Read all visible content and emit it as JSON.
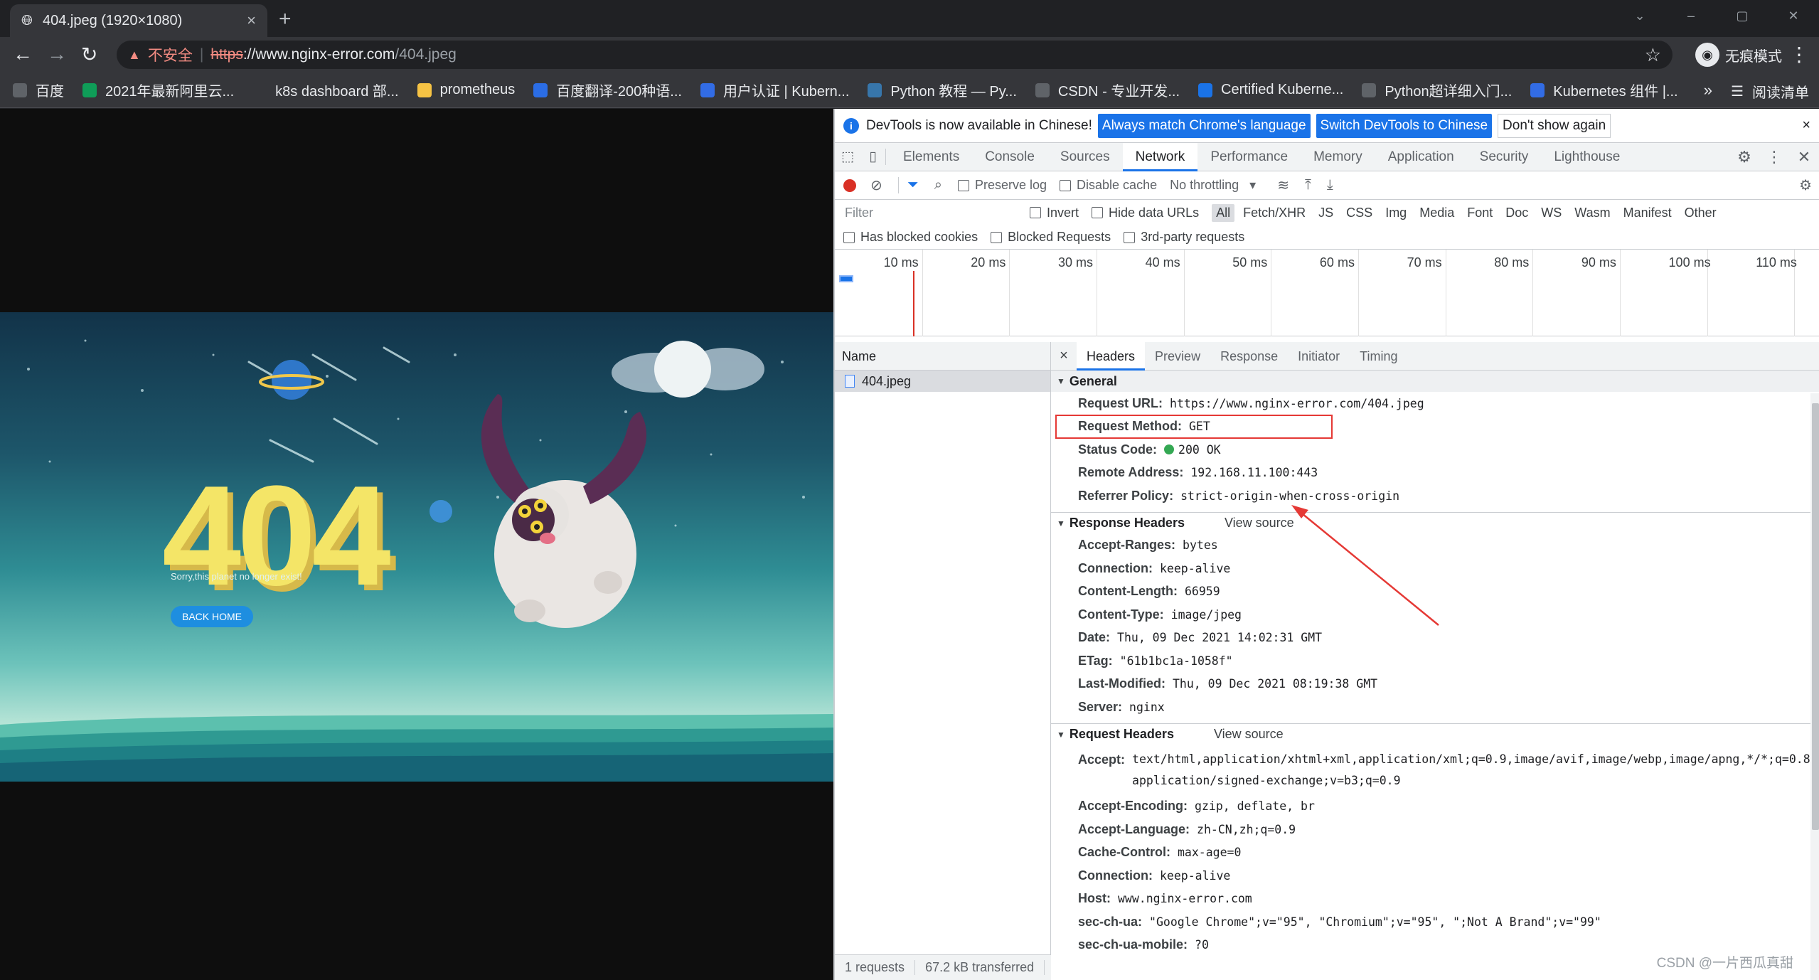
{
  "browser": {
    "tab_title": "404.jpeg (1920×1080)",
    "tab_close": "×",
    "new_tab": "+",
    "window_controls": [
      "⌄",
      "–",
      "▢",
      "✕"
    ],
    "insecure_label": "不安全",
    "url_scheme": "https",
    "url_host": "://www.nginx-error.com",
    "url_path": "/404.jpeg",
    "incognito_label": "无痕模式",
    "bookmarks": [
      {
        "label": "百度",
        "icon": "globe-icon",
        "color": "#5f6368"
      },
      {
        "label": "2021年最新阿里云...",
        "icon": "aliyun-icon",
        "color": "#0f9d58"
      },
      {
        "label": "k8s dashboard 部...",
        "icon": "k8s-icon",
        "color": "#35363a"
      },
      {
        "label": "prometheus",
        "icon": "folder-icon",
        "color": "#f6c344"
      },
      {
        "label": "百度翻译-200种语...",
        "icon": "translate-icon",
        "color": "#2b6de5"
      },
      {
        "label": "用户认证 | Kubern...",
        "icon": "kubernetes-icon",
        "color": "#326ce5"
      },
      {
        "label": "Python 教程 — Py...",
        "icon": "python-icon",
        "color": "#3776ab"
      },
      {
        "label": "CSDN - 专业开发...",
        "icon": "globe-icon",
        "color": "#5f6368"
      },
      {
        "label": "Certified Kuberne...",
        "icon": "cncf-icon",
        "color": "#1a73e8"
      },
      {
        "label": "Python超详细入门...",
        "icon": "globe-icon",
        "color": "#5f6368"
      },
      {
        "label": "Kubernetes 组件 |...",
        "icon": "kubernetes-icon",
        "color": "#326ce5"
      }
    ],
    "bookmarks_more": "»",
    "reading_list": "阅读清单"
  },
  "page": {
    "headline": "404",
    "subtitle": "Sorry,this planet no longer exist!",
    "button": "BACK HOME"
  },
  "devtools": {
    "infobar": {
      "message": "DevTools is now available in Chinese!",
      "btn_match": "Always match Chrome's language",
      "btn_switch": "Switch DevTools to Chinese",
      "btn_dismiss": "Don't show again",
      "close": "×"
    },
    "tabs": [
      "Elements",
      "Console",
      "Sources",
      "Network",
      "Performance",
      "Memory",
      "Application",
      "Security",
      "Lighthouse"
    ],
    "active_tab": "Network",
    "toolbar": {
      "preserve_log": "Preserve log",
      "disable_cache": "Disable cache",
      "throttling": "No throttling"
    },
    "filter": {
      "placeholder": "Filter",
      "invert": "Invert",
      "hide_data_urls": "Hide data URLs",
      "types": [
        "All",
        "Fetch/XHR",
        "JS",
        "CSS",
        "Img",
        "Media",
        "Font",
        "Doc",
        "WS",
        "Wasm",
        "Manifest",
        "Other"
      ],
      "active_type": "All",
      "has_blocked_cookies": "Has blocked cookies",
      "blocked_requests": "Blocked Requests",
      "third_party": "3rd-party requests"
    },
    "timeline_ticks": [
      "10 ms",
      "20 ms",
      "30 ms",
      "40 ms",
      "50 ms",
      "60 ms",
      "70 ms",
      "80 ms",
      "90 ms",
      "100 ms",
      "110 ms"
    ],
    "name_header": "Name",
    "requests": [
      {
        "name": "404.jpeg"
      }
    ],
    "status": {
      "requests": "1 requests",
      "transferred": "67.2 kB transferred"
    },
    "detail_tabs": [
      "Headers",
      "Preview",
      "Response",
      "Initiator",
      "Timing"
    ],
    "active_detail_tab": "Headers",
    "general": {
      "title": "General",
      "rows": [
        {
          "k": "Request URL:",
          "v": "https://www.nginx-error.com/404.jpeg"
        },
        {
          "k": "Request Method:",
          "v": "GET"
        },
        {
          "k": "Status Code:",
          "v": "200 OK"
        },
        {
          "k": "Remote Address:",
          "v": "192.168.11.100:443"
        },
        {
          "k": "Referrer Policy:",
          "v": "strict-origin-when-cross-origin"
        }
      ]
    },
    "response_headers": {
      "title": "Response Headers",
      "view_source": "View source",
      "rows": [
        {
          "k": "Accept-Ranges:",
          "v": "bytes"
        },
        {
          "k": "Connection:",
          "v": "keep-alive"
        },
        {
          "k": "Content-Length:",
          "v": "66959"
        },
        {
          "k": "Content-Type:",
          "v": "image/jpeg"
        },
        {
          "k": "Date:",
          "v": "Thu, 09 Dec 2021 14:02:31 GMT"
        },
        {
          "k": "ETag:",
          "v": "\"61b1bc1a-1058f\""
        },
        {
          "k": "Last-Modified:",
          "v": "Thu, 09 Dec 2021 08:19:38 GMT"
        },
        {
          "k": "Server:",
          "v": "nginx"
        }
      ]
    },
    "request_headers": {
      "title": "Request Headers",
      "view_source": "View source",
      "rows": [
        {
          "k": "Accept:",
          "v": "text/html,application/xhtml+xml,application/xml;q=0.9,image/avif,image/webp,image/apng,*/*;q=0.8,application/signed-exchange;v=b3;q=0.9"
        },
        {
          "k": "Accept-Encoding:",
          "v": "gzip, deflate, br"
        },
        {
          "k": "Accept-Language:",
          "v": "zh-CN,zh;q=0.9"
        },
        {
          "k": "Cache-Control:",
          "v": "max-age=0"
        },
        {
          "k": "Connection:",
          "v": "keep-alive"
        },
        {
          "k": "Host:",
          "v": "www.nginx-error.com"
        },
        {
          "k": "sec-ch-ua:",
          "v": "\"Google Chrome\";v=\"95\", \"Chromium\";v=\"95\", \";Not A Brand\";v=\"99\""
        },
        {
          "k": "sec-ch-ua-mobile:",
          "v": "?0"
        }
      ]
    },
    "status_color": "#34a853",
    "highlight_color": "#e53935"
  },
  "watermark": "CSDN @一片西瓜真甜"
}
